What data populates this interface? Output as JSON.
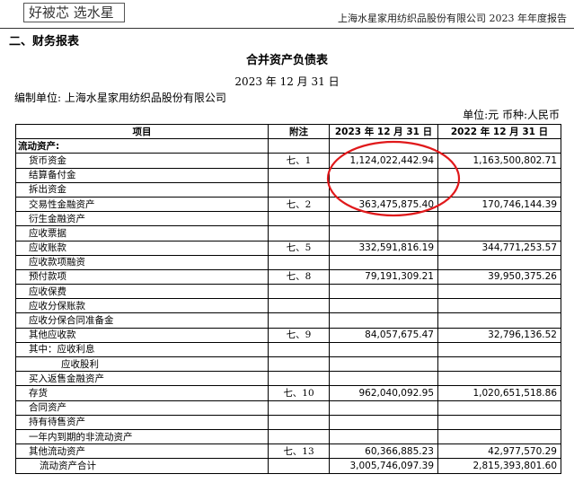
{
  "header": {
    "logo_text": "好被芯 选水星",
    "report_title": "上海水星家用纺织品股份有限公司  2023 年年度报告"
  },
  "section_title": "二、财务报表",
  "statement": {
    "title": "合并资产负债表",
    "date": "2023 年 12 月 31 日",
    "prepared_by": "编制单位: 上海水星家用纺织品股份有限公司",
    "currency_note": "单位:元  币种:人民币"
  },
  "table": {
    "columns": [
      "项目",
      "附注",
      "2023 年 12 月 31 日",
      "2022 年 12 月 31 日"
    ],
    "rows": [
      {
        "name": "流动资产:",
        "note": "",
        "v2023": "",
        "v2022": "",
        "indent": 0,
        "category": true
      },
      {
        "name": "货币资金",
        "note": "七、1",
        "v2023": "1,124,022,442.94",
        "v2022": "1,163,500,802.71",
        "indent": 1
      },
      {
        "name": "结算备付金",
        "note": "",
        "v2023": "",
        "v2022": "",
        "indent": 1
      },
      {
        "name": "拆出资金",
        "note": "",
        "v2023": "",
        "v2022": "",
        "indent": 1
      },
      {
        "name": "交易性金融资产",
        "note": "七、2",
        "v2023": "363,475,875.40",
        "v2022": "170,746,144.39",
        "indent": 1
      },
      {
        "name": "衍生金融资产",
        "note": "",
        "v2023": "",
        "v2022": "",
        "indent": 1
      },
      {
        "name": "应收票据",
        "note": "",
        "v2023": "",
        "v2022": "",
        "indent": 1
      },
      {
        "name": "应收账款",
        "note": "七、5",
        "v2023": "332,591,816.19",
        "v2022": "344,771,253.57",
        "indent": 1
      },
      {
        "name": "应收款项融资",
        "note": "",
        "v2023": "",
        "v2022": "",
        "indent": 1
      },
      {
        "name": "预付款项",
        "note": "七、8",
        "v2023": "79,191,309.21",
        "v2022": "39,950,375.26",
        "indent": 1
      },
      {
        "name": "应收保费",
        "note": "",
        "v2023": "",
        "v2022": "",
        "indent": 1
      },
      {
        "name": "应收分保账款",
        "note": "",
        "v2023": "",
        "v2022": "",
        "indent": 1
      },
      {
        "name": "应收分保合同准备金",
        "note": "",
        "v2023": "",
        "v2022": "",
        "indent": 1
      },
      {
        "name": "其他应收款",
        "note": "七、9",
        "v2023": "84,057,675.47",
        "v2022": "32,796,136.52",
        "indent": 1
      },
      {
        "name": "其中：应收利息",
        "note": "",
        "v2023": "",
        "v2022": "",
        "indent": 1
      },
      {
        "name": "应收股利",
        "note": "",
        "v2023": "",
        "v2022": "",
        "indent": 4
      },
      {
        "name": "买入返售金融资产",
        "note": "",
        "v2023": "",
        "v2022": "",
        "indent": 1
      },
      {
        "name": "存货",
        "note": "七、10",
        "v2023": "962,040,092.95",
        "v2022": "1,020,651,518.86",
        "indent": 1
      },
      {
        "name": "合同资产",
        "note": "",
        "v2023": "",
        "v2022": "",
        "indent": 1
      },
      {
        "name": "持有待售资产",
        "note": "",
        "v2023": "",
        "v2022": "",
        "indent": 1
      },
      {
        "name": "一年内到期的非流动资产",
        "note": "",
        "v2023": "",
        "v2022": "",
        "indent": 1
      },
      {
        "name": "其他流动资产",
        "note": "七、13",
        "v2023": "60,366,885.23",
        "v2022": "42,977,570.29",
        "indent": 1
      },
      {
        "name": "流动资产合计",
        "note": "",
        "v2023": "3,005,746,097.39",
        "v2022": "2,815,393,801.60",
        "indent": 2
      }
    ]
  },
  "annotation": {
    "color": "#e0191b"
  }
}
